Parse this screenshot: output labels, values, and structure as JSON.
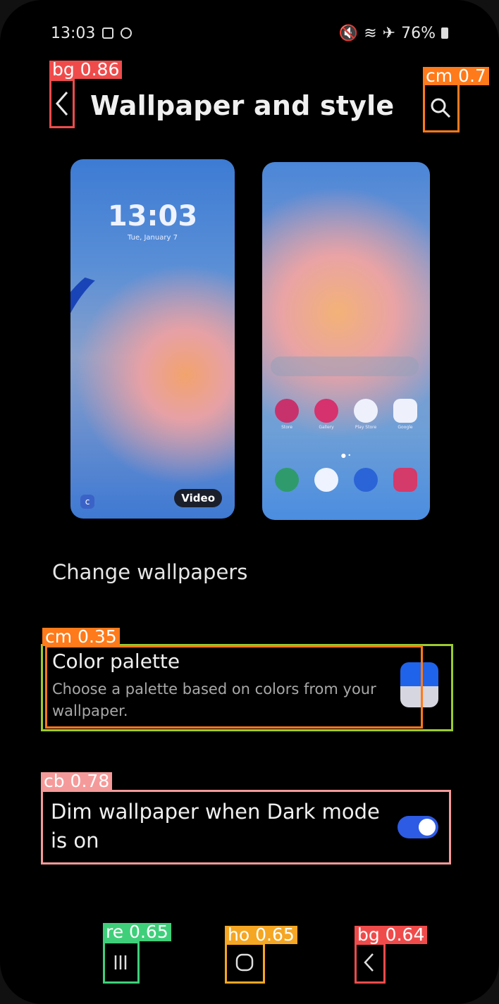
{
  "status_bar": {
    "time": "13:03",
    "battery": "76%"
  },
  "header": {
    "title": "Wallpaper and style"
  },
  "previews": {
    "lock_time": "13:03",
    "lock_date": "Tue, January 7",
    "video_label": "Video",
    "home_apps": [
      "Store",
      "Gallery",
      "Play Store",
      "Google"
    ]
  },
  "main": {
    "change_wallpapers": "Change wallpapers",
    "color_palette": {
      "title": "Color palette",
      "description": "Choose a palette based on colors from your wallpaper."
    },
    "dim_wallpaper": {
      "label": "Dim wallpaper when Dark mode is on",
      "enabled": true
    }
  },
  "annotations": [
    {
      "label": "bg 0.86",
      "color": "#f04b4b"
    },
    {
      "label": "cm 0.7",
      "color": "#ff7a1a"
    },
    {
      "label": "cm 0.35",
      "color": "#ff7a1a"
    },
    {
      "label": "cb 0.78",
      "color": "#f59a9a"
    },
    {
      "label": "re 0.65",
      "color": "#3fcf7a"
    },
    {
      "label": "ho 0.65",
      "color": "#f5a623"
    },
    {
      "label": "bg 0.64",
      "color": "#f04b4b"
    }
  ]
}
